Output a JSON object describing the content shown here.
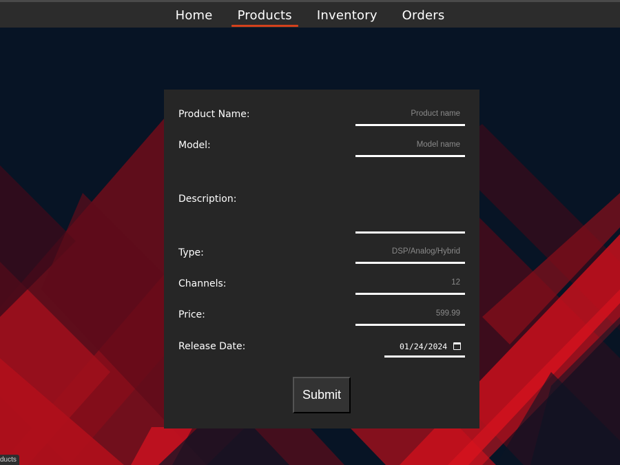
{
  "nav": {
    "items": [
      {
        "label": "Home"
      },
      {
        "label": "Products"
      },
      {
        "label": "Inventory"
      },
      {
        "label": "Orders"
      }
    ],
    "active": "Products",
    "accent_color": "#d4411c"
  },
  "form": {
    "product_name": {
      "label": "Product Name:",
      "placeholder": "Product name"
    },
    "model": {
      "label": "Model:",
      "placeholder": "Model name"
    },
    "description": {
      "label": "Description:",
      "placeholder": ""
    },
    "type": {
      "label": "Type:",
      "placeholder": "DSP/Analog/Hybrid"
    },
    "channels": {
      "label": "Channels:",
      "placeholder": "12"
    },
    "price": {
      "label": "Price:",
      "placeholder": "599.99"
    },
    "release_date": {
      "label": "Release Date:",
      "value": "01/24/2024",
      "icon": "calendar-icon"
    },
    "submit_label": "Submit"
  },
  "status_bar": {
    "link_text": "ducts"
  },
  "colors": {
    "background": "#071425",
    "navbar": "#2c2c2c",
    "panel": "#262626",
    "pattern_red": "#c8101c"
  }
}
